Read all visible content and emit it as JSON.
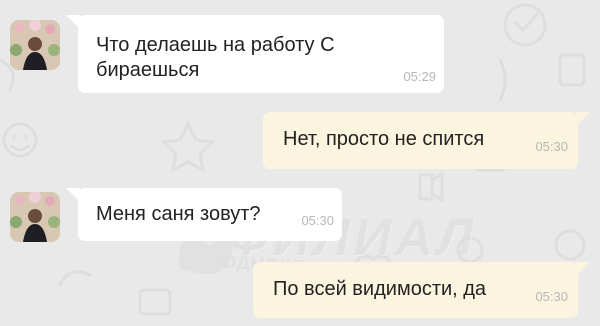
{
  "chat": {
    "messages": [
      {
        "direction": "incoming",
        "sender": "avatar",
        "lines": [
          "Что делаешь на работу С",
          "бираешься"
        ],
        "time": "05:29"
      },
      {
        "direction": "outgoing",
        "lines": [
          "Нет, просто не спится"
        ],
        "time": "05:30"
      },
      {
        "direction": "incoming",
        "sender": "avatar",
        "lines": [
          "Меня саня зовут?"
        ],
        "time": "05:30"
      },
      {
        "direction": "outgoing",
        "lines": [
          "По всей видимости, да"
        ],
        "time": "05:30"
      }
    ]
  },
  "watermark": {
    "main": "ФИЛИАЛ",
    "sub": "ОДНОКЛАССНИКОВ"
  },
  "colors": {
    "background": "#e9e9e9",
    "incoming_bubble": "#ffffff",
    "outgoing_bubble": "#fbf4de",
    "time_text": "#b7b7b7"
  },
  "icons": [
    "chat-doodle-pattern",
    "avatar-photo",
    "watermark-logo"
  ]
}
